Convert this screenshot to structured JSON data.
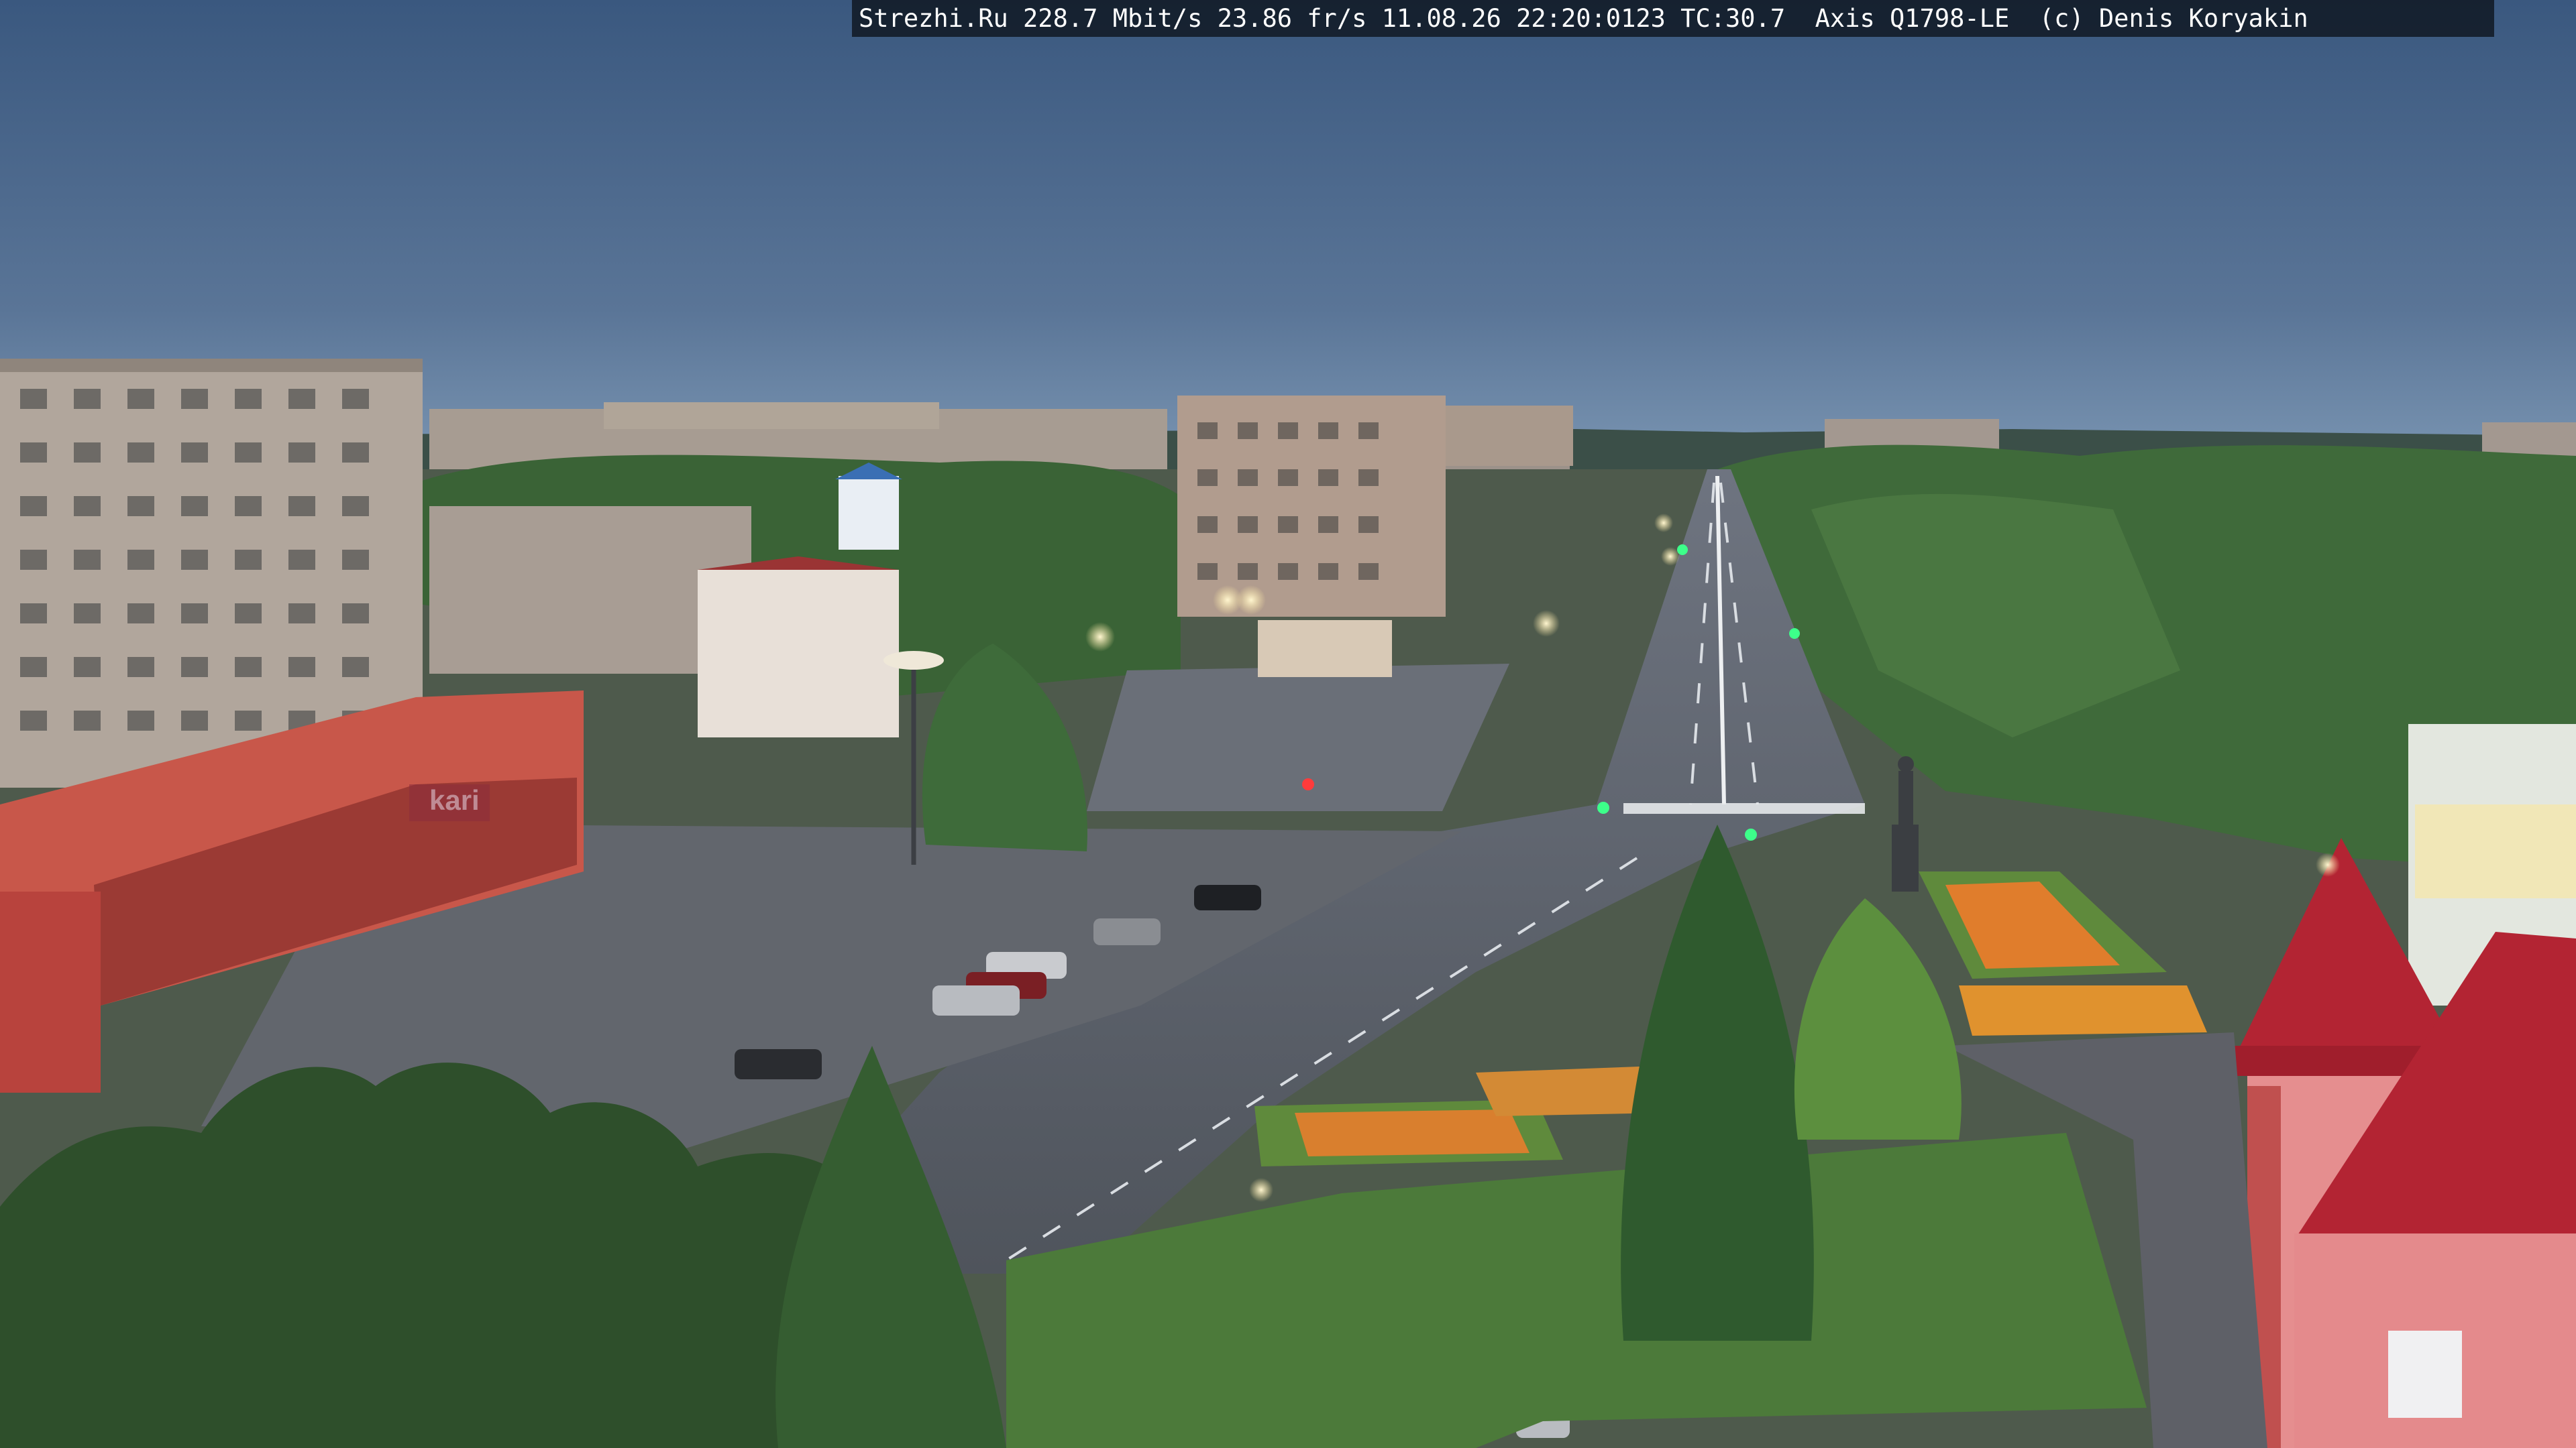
{
  "overlay": {
    "text": "Strezhi.Ru 228.7 Mbit/s 23.86 fr/s 11.08.26 22:20:0123 TC:30.7  Axis Q1798-LE  (c) Denis Koryakin"
  },
  "signs": {
    "storefront_brand": "kari"
  },
  "colors": {
    "sky_top": "#3b5a80",
    "sky_horizon": "#6f8aa8",
    "asphalt": "#5b6068",
    "trees": "#3f6a3a",
    "roof_red": "#b32433",
    "shop_facade": "#c8574a"
  }
}
